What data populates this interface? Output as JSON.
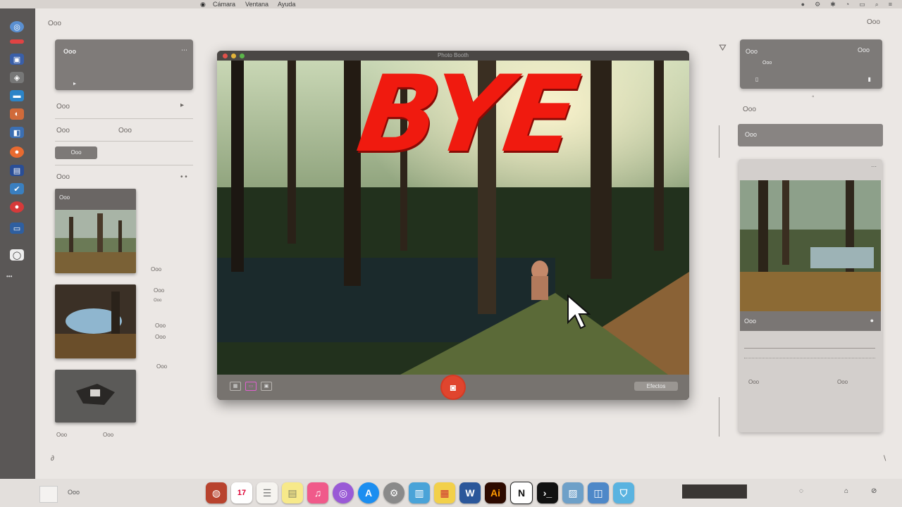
{
  "menubar": {
    "items": [
      "Cámara",
      "Ventana",
      "Ayuda"
    ],
    "status_icons": [
      "record-icon",
      "gear-icon",
      "bluetooth-icon",
      "wifi-icon",
      "battery-icon",
      "search-icon",
      "control-center-icon"
    ]
  },
  "desktop": {
    "top_left_label": "Ooo",
    "top_right_label": "Ooo"
  },
  "left_column": {
    "header_panel_title": "Ooo",
    "section_1_label": "Ooo",
    "row_left": "Ooo",
    "row_right": "Ooo",
    "chip": "Ooo",
    "section_2_label": "Ooo",
    "thumb_1_title": "Ooo",
    "thumb_side_1": "Ooo",
    "thumb_side_2a": "Ooo",
    "thumb_side_2b": "Ooo",
    "thumb_side_3a": "Ooo",
    "thumb_side_3b": "Ooo",
    "thumb_side_3c": "Ooo",
    "thumb_3_caption_a": "Ooo",
    "thumb_3_caption_b": "Ooo"
  },
  "photo_booth": {
    "window_title": "Photo Booth",
    "overlay_text": "BYE",
    "effects_button": "Efectos",
    "shutter_icon": "camera-icon"
  },
  "right_column": {
    "top_panel_left": "Ooo",
    "top_panel_right": "Ooo",
    "top_panel_sub": "Ooo",
    "section_label": "Ooo",
    "bar_label": "Ooo",
    "card_caption": "Ooo",
    "card_row_a": "Ooo",
    "card_row_b": "Ooo"
  },
  "dock": {
    "calendar_day": "17",
    "illustrator_label": "Ai",
    "word_label": "W",
    "notion_label": "N",
    "finder_label": "Ooo"
  },
  "colors": {
    "accent_red": "#f01a0f",
    "shutter": "#e0452e",
    "panel_gray": "#7f7b79"
  }
}
